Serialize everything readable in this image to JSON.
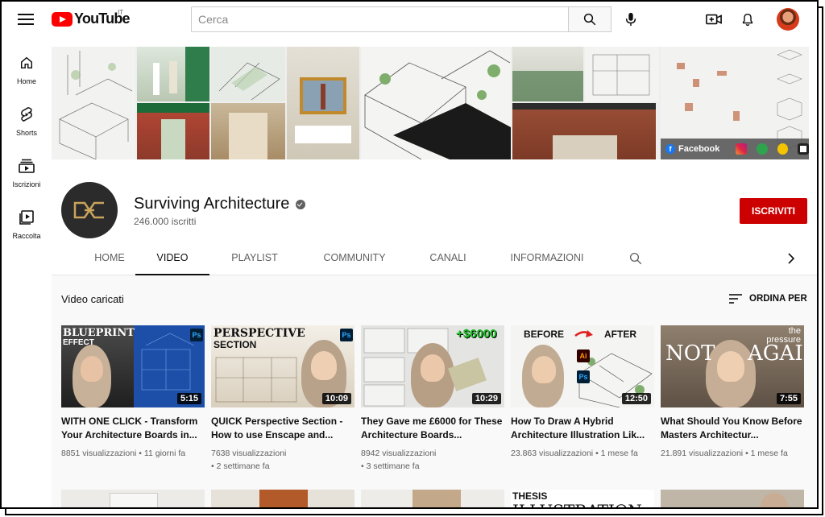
{
  "header": {
    "logo_text": "YouTube",
    "country_code": "IT",
    "search_placeholder": "Cerca"
  },
  "sidebar": {
    "items": [
      {
        "label": "Home",
        "icon": "home-icon"
      },
      {
        "label": "Shorts",
        "icon": "shorts-icon"
      },
      {
        "label": "Iscrizioni",
        "icon": "subscriptions-icon"
      },
      {
        "label": "Raccolta",
        "icon": "library-icon"
      }
    ]
  },
  "banner": {
    "facebook_label": "Facebook",
    "social_icons": [
      "instagram-icon",
      "houzz-icon",
      "archdaily-icon",
      "patreon-icon"
    ]
  },
  "channel": {
    "name": "Surviving Architecture",
    "subscribers": "246.000 iscritti",
    "subscribe_label": "ISCRIVITI"
  },
  "tabs": [
    {
      "label": "HOME",
      "active": false
    },
    {
      "label": "VIDEO",
      "active": true
    },
    {
      "label": "PLAYLIST",
      "active": false
    },
    {
      "label": "COMMUNITY",
      "active": false
    },
    {
      "label": "CANALI",
      "active": false
    },
    {
      "label": "INFORMAZIONI",
      "active": false
    }
  ],
  "content": {
    "section_title": "Video caricati",
    "sort_label": "ORDINA PER",
    "videos": [
      {
        "thumb_caption_1": "BLUEPRINT",
        "thumb_caption_2": "EFFECT",
        "duration": "5:15",
        "title": "WITH ONE CLICK - Transform Your Architecture Boards in...",
        "views": "8851 visualizzazioni",
        "age": "11 giorni fa"
      },
      {
        "thumb_caption_1": "PERSPECTIVE",
        "thumb_caption_2": "SECTION",
        "duration": "10:09",
        "title": "QUICK Perspective Section - How to use Enscape and...",
        "views": "7638 visualizzazioni",
        "age": "2 settimane fa"
      },
      {
        "thumb_caption_1": "+$6000",
        "thumb_caption_2": "",
        "duration": "10:29",
        "title": "They Gave me £6000 for These Architecture Boards...",
        "views": "8942 visualizzazioni",
        "age": "3 settimane fa"
      },
      {
        "thumb_caption_1": "BEFORE",
        "thumb_caption_2": "AFTER",
        "duration": "12:50",
        "title": "How To Draw A Hybrid Architecture Illustration Lik...",
        "views": "23.863 visualizzazioni",
        "age": "1 mese fa"
      },
      {
        "thumb_caption_1": "NOT",
        "thumb_caption_2": "AGAIN",
        "thumb_caption_3": "the pressure",
        "duration": "7:55",
        "title": "What Should You Know Before Masters Architectur...",
        "views": "21.891 visualizzazioni",
        "age": "1 mese fa"
      }
    ],
    "row2_caption_1": "THESIS",
    "row2_caption_2": "ILLUSTRATION"
  },
  "colors": {
    "brand_red": "#ff0000",
    "subscribe_red": "#cc0000",
    "text_primary": "#0f0f0f",
    "text_secondary": "#606060"
  }
}
